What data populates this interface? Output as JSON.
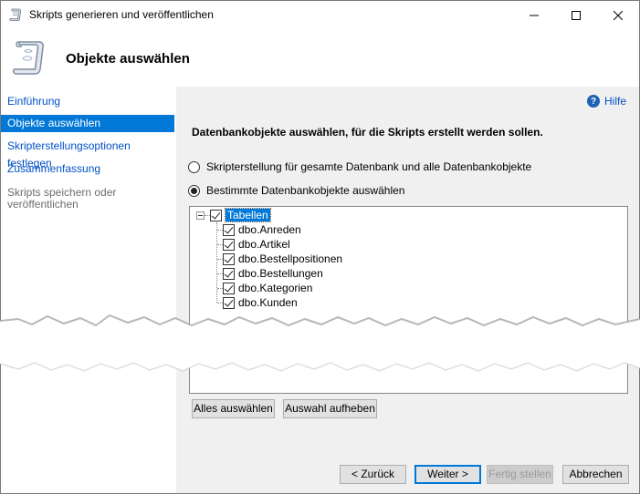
{
  "window": {
    "title": "Skripts generieren und veröffentlichen",
    "minimize_icon": "minimize-icon",
    "maximize_icon": "maximize-icon",
    "close_icon": "close-icon"
  },
  "header": {
    "title": "Objekte auswählen",
    "icon": "script-scroll-icon"
  },
  "nav": {
    "items": [
      {
        "label": "Einführung",
        "state": "link"
      },
      {
        "label": "Objekte auswählen",
        "state": "active"
      },
      {
        "label": "Skripterstellungsoptionen festlegen",
        "state": "link"
      },
      {
        "label": "Zusammenfassung",
        "state": "link"
      },
      {
        "label": "Skripts speichern oder veröffentlichen",
        "state": "disabled"
      }
    ]
  },
  "content": {
    "help_label": "Hilfe",
    "help_icon": "help-icon",
    "instruction": "Datenbankobjekte auswählen, für die Skripts erstellt werden sollen.",
    "radio_options": [
      {
        "label": "Skripterstellung für gesamte Datenbank und alle Datenbankobjekte",
        "checked": false
      },
      {
        "label": "Bestimmte Datenbankobjekte auswählen",
        "checked": true
      }
    ],
    "tree": {
      "root": {
        "label": "Tabellen",
        "checked": true,
        "expanded": true,
        "selected": true
      },
      "children": [
        {
          "label": "dbo.Anreden",
          "checked": true
        },
        {
          "label": "dbo.Artikel",
          "checked": true
        },
        {
          "label": "dbo.Bestellpositionen",
          "checked": true
        },
        {
          "label": "dbo.Bestellungen",
          "checked": true
        },
        {
          "label": "dbo.Kategorien",
          "checked": true
        },
        {
          "label": "dbo.Kunden",
          "checked": true
        }
      ]
    },
    "select_all_label": "Alles auswählen",
    "deselect_label": "Auswahl aufheben"
  },
  "footer": {
    "back_label": "< Zurück",
    "next_label": "Weiter >",
    "finish_label": "Fertig stellen",
    "cancel_label": "Abbrechen"
  },
  "colors": {
    "accent": "#0078d7",
    "link": "#0050c8",
    "content_bg": "#f0f0f0"
  }
}
